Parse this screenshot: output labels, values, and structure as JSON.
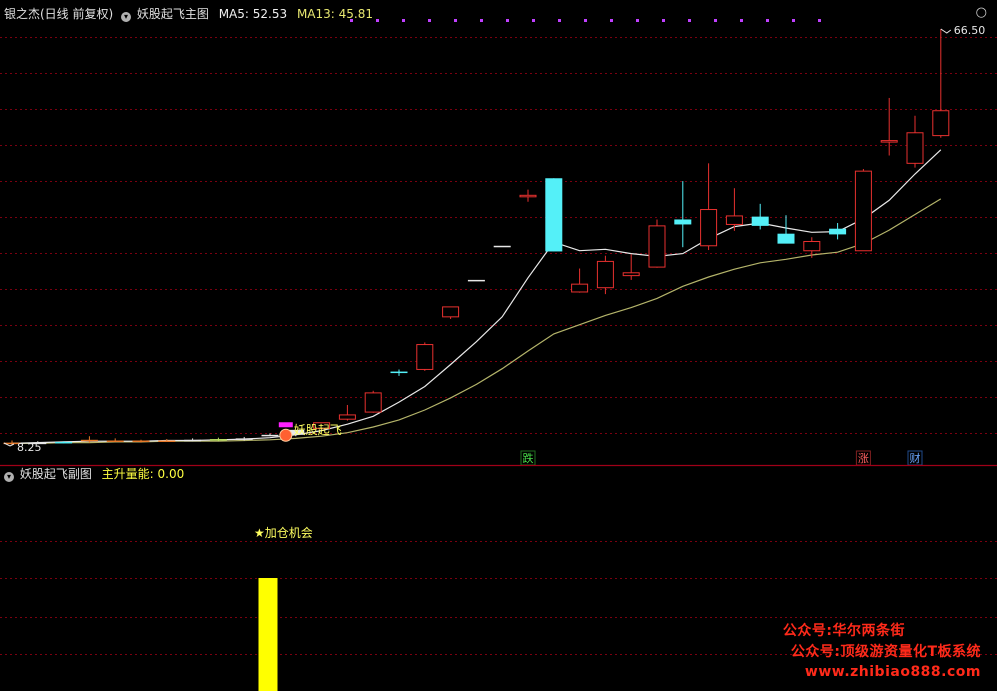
{
  "colors": {
    "up": "#e8312f",
    "down": "#54f0f8",
    "ma5": "#e9e9e9",
    "ma13": "#b4b46a",
    "signal_dots": "#c040ff",
    "grid": "#7a0010",
    "divider": "#a00018",
    "sub_bar": "#ffff00",
    "watermark": "#ff2a1a"
  },
  "main_header": {
    "stock_name": "银之杰(日线 前复权)",
    "indicator_name": "妖股起飞主图",
    "ma5_label": "MA5: 52.53",
    "ma13_label": "MA13: 45.81",
    "circle_glyph": "○"
  },
  "sub_header": {
    "indicator_name": "妖股起飞副图",
    "energy_label": "主升量能: 0.00"
  },
  "chart_data": [
    {
      "type": "candlestick",
      "ylim": [
        8.25,
        66.5
      ],
      "candles": [
        {
          "o": 8.1,
          "h": 8.6,
          "l": 7.9,
          "c": 8.3
        },
        {
          "o": 8.3,
          "h": 8.5,
          "l": 8.1,
          "c": 8.2
        },
        {
          "o": 8.3,
          "h": 8.5,
          "l": 8.2,
          "c": 8.4
        },
        {
          "o": 8.5,
          "h": 9.2,
          "l": 8.3,
          "c": 8.7
        },
        {
          "o": 8.6,
          "h": 8.9,
          "l": 8.4,
          "c": 8.5
        },
        {
          "o": 8.4,
          "h": 8.7,
          "l": 8.3,
          "c": 8.6
        },
        {
          "o": 8.5,
          "h": 8.8,
          "l": 8.4,
          "c": 8.6
        },
        {
          "o": 8.6,
          "h": 8.9,
          "l": 8.5,
          "c": 8.7
        },
        {
          "o": 8.7,
          "h": 9.0,
          "l": 8.5,
          "c": 8.8
        },
        {
          "o": 8.8,
          "h": 9.1,
          "l": 8.6,
          "c": 8.9
        },
        {
          "o": 9.3,
          "h": 9.6,
          "l": 9.2,
          "c": 9.4
        },
        {
          "o": 9.4,
          "h": 10.0,
          "l": 9.2,
          "c": 10.1
        },
        {
          "o": 10.3,
          "h": 11.1,
          "l": 10.2,
          "c": 11.1
        },
        {
          "o": 11.6,
          "h": 13.6,
          "l": 11.4,
          "c": 12.2
        },
        {
          "o": 12.6,
          "h": 15.6,
          "l": 12.5,
          "c": 15.3
        },
        {
          "o": 18.3,
          "h": 18.6,
          "l": 17.7,
          "c": 18.2
        },
        {
          "o": 18.6,
          "h": 22.4,
          "l": 18.4,
          "c": 22.1
        },
        {
          "o": 26.0,
          "h": 27.4,
          "l": 25.7,
          "c": 27.4
        },
        {
          "o": 31.2,
          "h": 31.2,
          "l": 31.2,
          "c": 31.2
        },
        {
          "o": 36.0,
          "h": 36.0,
          "l": 36.0,
          "c": 36.0
        },
        {
          "o": 43.1,
          "h": 43.9,
          "l": 42.2,
          "c": 43.1
        },
        {
          "o": 45.5,
          "h": 45.5,
          "l": 35.2,
          "c": 35.2
        },
        {
          "o": 29.5,
          "h": 32.8,
          "l": 29.4,
          "c": 30.6
        },
        {
          "o": 30.1,
          "h": 34.6,
          "l": 29.2,
          "c": 33.8
        },
        {
          "o": 31.8,
          "h": 34.8,
          "l": 31.2,
          "c": 32.2
        },
        {
          "o": 33.0,
          "h": 39.7,
          "l": 32.9,
          "c": 38.8
        },
        {
          "o": 39.7,
          "h": 45.1,
          "l": 35.8,
          "c": 39.0
        },
        {
          "o": 36.0,
          "h": 47.6,
          "l": 35.4,
          "c": 41.1
        },
        {
          "o": 39.0,
          "h": 44.1,
          "l": 38.1,
          "c": 40.2
        },
        {
          "o": 40.1,
          "h": 41.9,
          "l": 38.3,
          "c": 38.8
        },
        {
          "o": 37.7,
          "h": 40.3,
          "l": 36.5,
          "c": 36.3
        },
        {
          "o": 35.3,
          "h": 37.2,
          "l": 34.3,
          "c": 36.6
        },
        {
          "o": 38.4,
          "h": 39.2,
          "l": 36.9,
          "c": 37.6
        },
        {
          "o": 35.3,
          "h": 46.8,
          "l": 35.3,
          "c": 46.5
        },
        {
          "o": 50.7,
          "h": 56.8,
          "l": 48.7,
          "c": 50.8
        },
        {
          "o": 47.6,
          "h": 54.3,
          "l": 47.0,
          "c": 51.9
        },
        {
          "o": 51.5,
          "h": 66.5,
          "l": 51.2,
          "c": 55.0
        }
      ],
      "ma5": [
        8.2,
        8.3,
        8.4,
        8.5,
        8.5,
        8.5,
        8.6,
        8.6,
        8.7,
        8.8,
        9.0,
        9.4,
        10.0,
        10.9,
        12.0,
        14.0,
        16.2,
        19.3,
        22.5,
        26.0,
        31.5,
        36.5,
        35.3,
        35.5,
        34.9,
        34.5,
        34.9,
        37.0,
        38.7,
        39.2,
        38.5,
        37.9,
        38.0,
        39.8,
        42.4,
        46.1,
        49.5
      ],
      "ma13": [
        8.2,
        8.2,
        8.3,
        8.3,
        8.4,
        8.4,
        8.5,
        8.5,
        8.5,
        8.6,
        8.7,
        8.9,
        9.2,
        9.7,
        10.5,
        11.5,
        12.9,
        14.6,
        16.5,
        18.7,
        21.2,
        23.6,
        24.9,
        26.2,
        27.3,
        28.6,
        30.3,
        31.6,
        32.7,
        33.6,
        34.1,
        34.7,
        35.1,
        36.3,
        38.2,
        40.4,
        42.6
      ],
      "signal_dots": 19,
      "annotations": {
        "high_label": "66.50",
        "low_label": "8.25",
        "start_label": "妖股起飞",
        "tags": [
          {
            "text": "跌",
            "color": "#49e049",
            "border": "#1f6f1f",
            "index": 20
          },
          {
            "text": "涨",
            "color": "#ff6060",
            "border": "#802020",
            "index": 33
          },
          {
            "text": "财",
            "color": "#6aa6ff",
            "border": "#204a8a",
            "index": 35
          }
        ]
      }
    },
    {
      "type": "bar",
      "series": [
        {
          "name": "主升量能",
          "values": [
            0,
            0,
            0,
            0,
            0,
            0,
            0,
            0,
            0,
            0,
            1,
            0,
            0,
            0,
            0,
            0,
            0,
            0,
            0,
            0,
            0,
            0,
            0,
            0,
            0,
            0,
            0,
            0,
            0,
            0,
            0,
            0,
            0,
            0,
            0,
            0,
            0
          ]
        }
      ],
      "annotations": {
        "star_label": "★加仓机会"
      }
    }
  ],
  "watermark": {
    "line1": "公众号:华尔两条街",
    "line2": "公众号:顶级游资量化T板系统",
    "line3": "www.zhibiao888.com"
  }
}
